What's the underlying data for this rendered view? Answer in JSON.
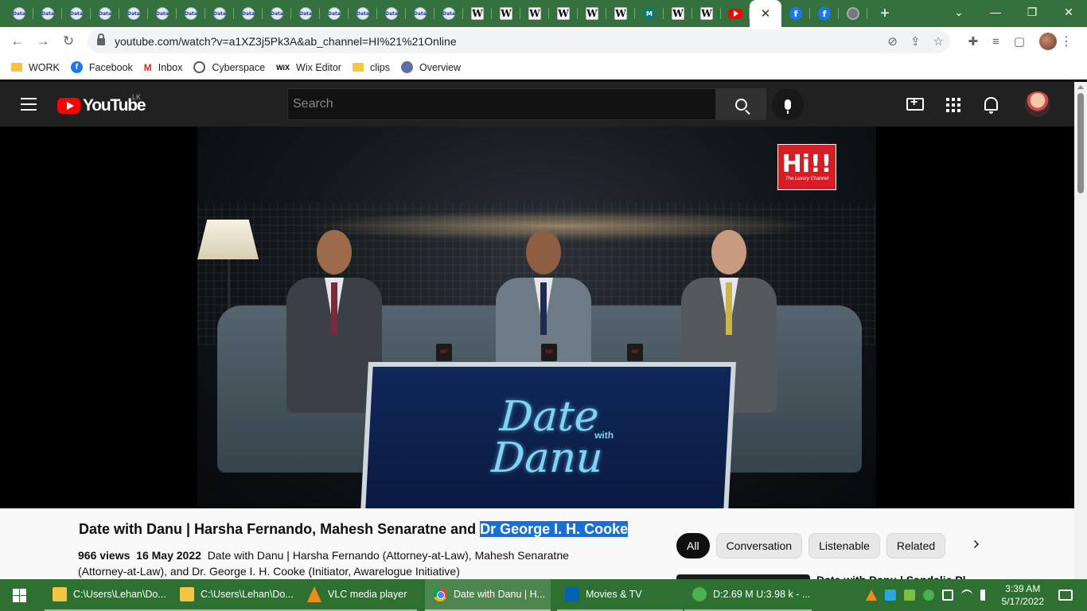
{
  "browser": {
    "tabs": [
      {
        "kind": "data",
        "label": "Data"
      },
      {
        "kind": "data",
        "label": "Data"
      },
      {
        "kind": "data",
        "label": "Data"
      },
      {
        "kind": "data",
        "label": "Data"
      },
      {
        "kind": "data",
        "label": "Data"
      },
      {
        "kind": "data",
        "label": "Data"
      },
      {
        "kind": "data",
        "label": "Data"
      },
      {
        "kind": "data",
        "label": "Data"
      },
      {
        "kind": "data",
        "label": "Data"
      },
      {
        "kind": "data",
        "label": "Data"
      },
      {
        "kind": "data",
        "label": "Data"
      },
      {
        "kind": "data",
        "label": "Data"
      },
      {
        "kind": "data",
        "label": "Data"
      },
      {
        "kind": "data",
        "label": "Data"
      },
      {
        "kind": "data",
        "label": "Data"
      },
      {
        "kind": "data",
        "label": "Data"
      },
      {
        "kind": "wiki",
        "label": "W"
      },
      {
        "kind": "wiki",
        "label": "W"
      },
      {
        "kind": "wiki",
        "label": "W"
      },
      {
        "kind": "wiki",
        "label": "W"
      },
      {
        "kind": "wiki",
        "label": "W"
      },
      {
        "kind": "wiki",
        "label": "W"
      },
      {
        "kind": "mendeley",
        "label": "M"
      },
      {
        "kind": "wiki",
        "label": "W"
      },
      {
        "kind": "wiki",
        "label": "W"
      },
      {
        "kind": "youtube",
        "label": ""
      }
    ],
    "active_tab_close": "✕",
    "trailing_tabs": [
      {
        "kind": "facebook",
        "label": "f"
      },
      {
        "kind": "facebook",
        "label": "f"
      },
      {
        "kind": "grey",
        "label": ""
      }
    ],
    "new_tab": "+",
    "window_controls": {
      "dropdown": "⌄",
      "minimize": "—",
      "maximize": "❐",
      "close": "✕"
    },
    "nav": {
      "back": "←",
      "forward": "→",
      "reload": "↻"
    },
    "url": "youtube.com/watch?v=a1XZ3j5Pk3A&ab_channel=HI%21%21Online",
    "omnibox_icons": {
      "eye_off": "⊘",
      "share": "⇪",
      "star": "☆"
    },
    "toolbar_icons": {
      "extensions": "✚",
      "media": "≡",
      "sidepanel": "▢",
      "menu": "⋮"
    },
    "bookmarks": [
      {
        "icon": "folder",
        "label": "WORK"
      },
      {
        "icon": "facebook",
        "label": "Facebook"
      },
      {
        "icon": "gmail",
        "label": "Inbox"
      },
      {
        "icon": "cyberspace",
        "label": "Cyberspace"
      },
      {
        "icon": "wix",
        "label": "Wix Editor"
      },
      {
        "icon": "folder",
        "label": "clips"
      },
      {
        "icon": "overview",
        "label": "Overview"
      }
    ]
  },
  "youtube": {
    "logo_text": "YouTube",
    "region": "LK",
    "search_placeholder": "Search",
    "video": {
      "channel_logo": "Hi!!",
      "channel_logo_sub": "The Luxury Channel",
      "desk_title": "Date",
      "desk_title_2": "Danu",
      "desk_with": "with",
      "mug_label": "Hi!!"
    },
    "title_main": "Date with Danu | Harsha Fernando, Mahesh Senaratne and ",
    "title_highlight": "Dr George I. H. Cooke",
    "views": "966 views",
    "date": "16 May 2022",
    "description": "Date with Danu | Harsha Fernando (Attorney-at-Law), Mahesh Senaratne (Attorney-at-Law), and Dr. George I. H. Cooke (Initiator, Awarelogue Initiative)",
    "chips": [
      "All",
      "Conversation",
      "Listenable",
      "Related"
    ],
    "related_title": "Date with Danu | Sandalie Pl..."
  },
  "taskbar": {
    "items": [
      {
        "icon": "folder",
        "label": "C:\\Users\\Lehan\\Do..."
      },
      {
        "icon": "folder",
        "label": "C:\\Users\\Lehan\\Do..."
      },
      {
        "icon": "vlc",
        "label": "VLC media player"
      },
      {
        "icon": "chrome",
        "label": "Date with Danu | H..."
      },
      {
        "icon": "movies",
        "label": "Movies & TV"
      },
      {
        "icon": "utorrent",
        "label": "D:2.69 M U:3.98 k - ..."
      }
    ],
    "time": "3:39 AM",
    "date": "5/17/2022"
  }
}
